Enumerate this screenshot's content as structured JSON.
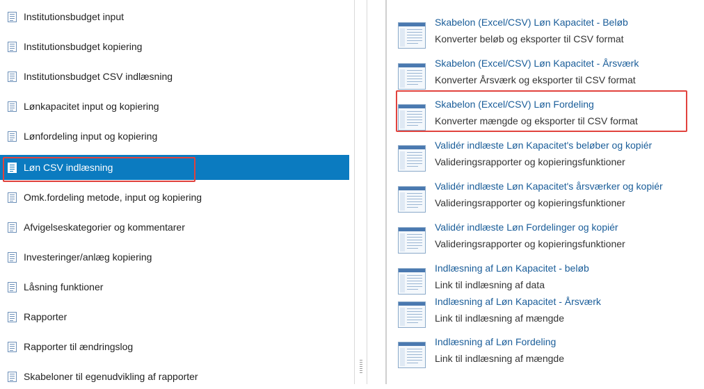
{
  "nav": {
    "items": [
      {
        "label": "Institutionsbudget input",
        "icon": "document-icon"
      },
      {
        "label": "Institutionsbudget kopiering",
        "icon": "document-icon"
      },
      {
        "label": "Institutionsbudget CSV indlæsning",
        "icon": "document-icon"
      },
      {
        "label": "Lønkapacitet input og kopiering",
        "icon": "document-icon"
      },
      {
        "label": "Lønfordeling input og kopiering",
        "icon": "document-icon"
      },
      {
        "label": "Løn CSV indlæsning",
        "icon": "document-icon",
        "active": true
      },
      {
        "label": "Omk.fordeling metode, input og kopiering",
        "icon": "document-icon"
      },
      {
        "label": "Afvigelseskategorier og kommentarer",
        "icon": "document-icon"
      },
      {
        "label": "Investeringer/anlæg kopiering",
        "icon": "document-icon"
      },
      {
        "label": "Låsning funktioner",
        "icon": "document-icon"
      },
      {
        "label": "Rapporter",
        "icon": "document-icon"
      },
      {
        "label": "Rapporter til ændringslog",
        "icon": "document-icon"
      },
      {
        "label": "Skabeloner til egenudvikling af rapporter",
        "icon": "document-icon"
      }
    ]
  },
  "entries": [
    {
      "title": "Skabelon (Excel/CSV) Løn Kapacitet - Beløb",
      "desc": "Konverter beløb og eksporter til CSV format",
      "icon": "report-document-icon"
    },
    {
      "title": "Skabelon (Excel/CSV) Løn Kapacitet - Årsværk",
      "desc": "Konverter Årsværk og eksporter til CSV format",
      "icon": "report-document-icon"
    },
    {
      "title": "Skabelon (Excel/CSV) Løn Fordeling",
      "desc": "Konverter mængde og eksporter til CSV format",
      "icon": "report-document-icon"
    },
    {
      "title": "Validér indlæste Løn Kapacitet's beløber og kopiér",
      "desc": "Valideringsrapporter og kopieringsfunktioner",
      "icon": "report-document-icon"
    },
    {
      "title": "Validér indlæste Løn Kapacitet's årsværker og kopiér",
      "desc": "Valideringsrapporter og kopieringsfunktioner",
      "icon": "report-document-icon"
    },
    {
      "title": "Validér indlæste Løn Fordelinger og kopiér",
      "desc": "Valideringsrapporter og kopieringsfunktioner",
      "icon": "report-document-icon"
    },
    {
      "title": "Indlæsning af Løn Kapacitet - beløb",
      "desc": "Link til indlæsning af data",
      "icon": "report-document-icon"
    },
    {
      "title": "Indlæsning af Løn Kapacitet - Årsværk",
      "desc": "Link til indlæsning af mængde",
      "icon": "report-document-icon"
    },
    {
      "title": "Indlæsning af Løn Fordeling",
      "desc": "Link til indlæsning af mængde",
      "icon": "report-document-icon"
    }
  ],
  "colors": {
    "active_bg": "#0b7bc0",
    "link": "#1a5d99",
    "highlight": "#e1423d"
  }
}
